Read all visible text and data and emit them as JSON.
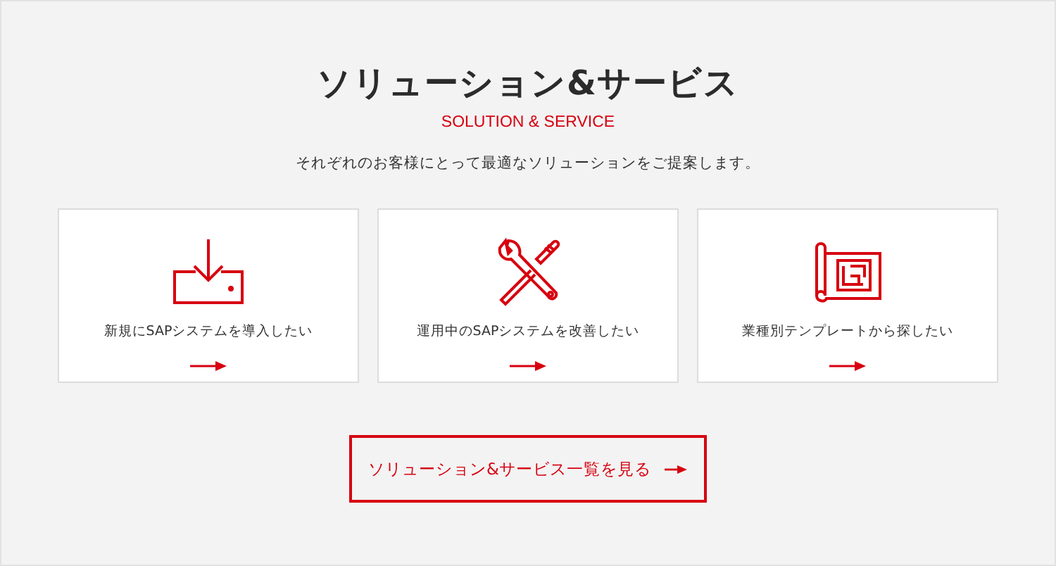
{
  "heading": {
    "title": "ソリューション&サービス",
    "subtitle": "SOLUTION & SERVICE",
    "description": "それぞれのお客様にとって最適なソリューションをご提案します。"
  },
  "cards": [
    {
      "kind": "download",
      "label": "新規にSAPシステムを導入したい"
    },
    {
      "kind": "tools",
      "label": "運用中のSAPシステムを改善したい"
    },
    {
      "kind": "blueprint",
      "label": "業種別テンプレートから探したい"
    }
  ],
  "button": {
    "label": "ソリューション&サービス一覧を見る"
  }
}
